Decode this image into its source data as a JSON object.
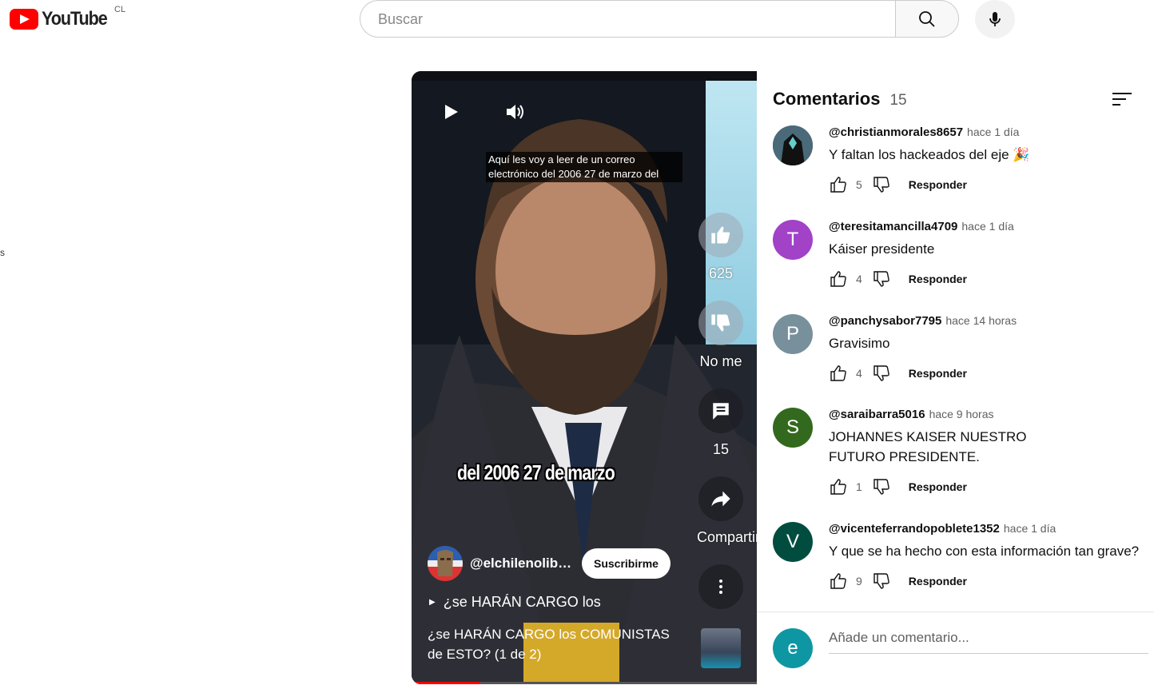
{
  "header": {
    "logo_text": "YouTube",
    "country_code": "CL",
    "search_placeholder": "Buscar"
  },
  "sidebar_fragment": "s",
  "video": {
    "caption": "Aquí les voy a leer de un correo electrónico del 2006 27 de marzo del",
    "subtitle": "del 2006 27 de marzo",
    "like_count": "625",
    "dislike_label": "No me",
    "comment_count": "15",
    "share_label": "Compartir",
    "channel_name": "@elchilenolibe...",
    "subscribe_label": "Suscribirme",
    "playlist_label": "¿se HARÁN CARGO los",
    "title": "¿se HARÁN CARGO los COMUNISTAS de ESTO? (1 de 2)",
    "progress": 0.2
  },
  "comments_panel": {
    "title": "Comentarios",
    "count": "15",
    "reply_label": "Responder",
    "add_placeholder": "Añade un comentario...",
    "current_user_initial": "e",
    "comments": [
      {
        "user": "@christianmorales8657",
        "time": "hace 1 día",
        "text": "Y faltan los hackeados del eje 🎉",
        "likes": "5",
        "avatar_initial": "",
        "avatar_color": "#2a3b4d"
      },
      {
        "user": "@teresitamancilla4709",
        "time": "hace 1 día",
        "text": "Káiser presidente",
        "likes": "4",
        "avatar_initial": "T",
        "avatar_color": "#a142c7"
      },
      {
        "user": "@panchysabor7795",
        "time": "hace 14 horas",
        "text": "Gravisimo",
        "likes": "4",
        "avatar_initial": "P",
        "avatar_color": "#78909c"
      },
      {
        "user": "@saraibarra5016",
        "time": "hace 9 horas",
        "text": "JOHANNES KAISER NUESTRO FUTURO PRESIDENTE.",
        "likes": "1",
        "avatar_initial": "S",
        "avatar_color": "#33691e"
      },
      {
        "user": "@vicenteferrandopoblete1352",
        "time": "hace 1 día",
        "text": "Y que se ha hecho con esta información tan grave?",
        "likes": "9",
        "avatar_initial": "V",
        "avatar_color": "#004d40"
      }
    ]
  }
}
